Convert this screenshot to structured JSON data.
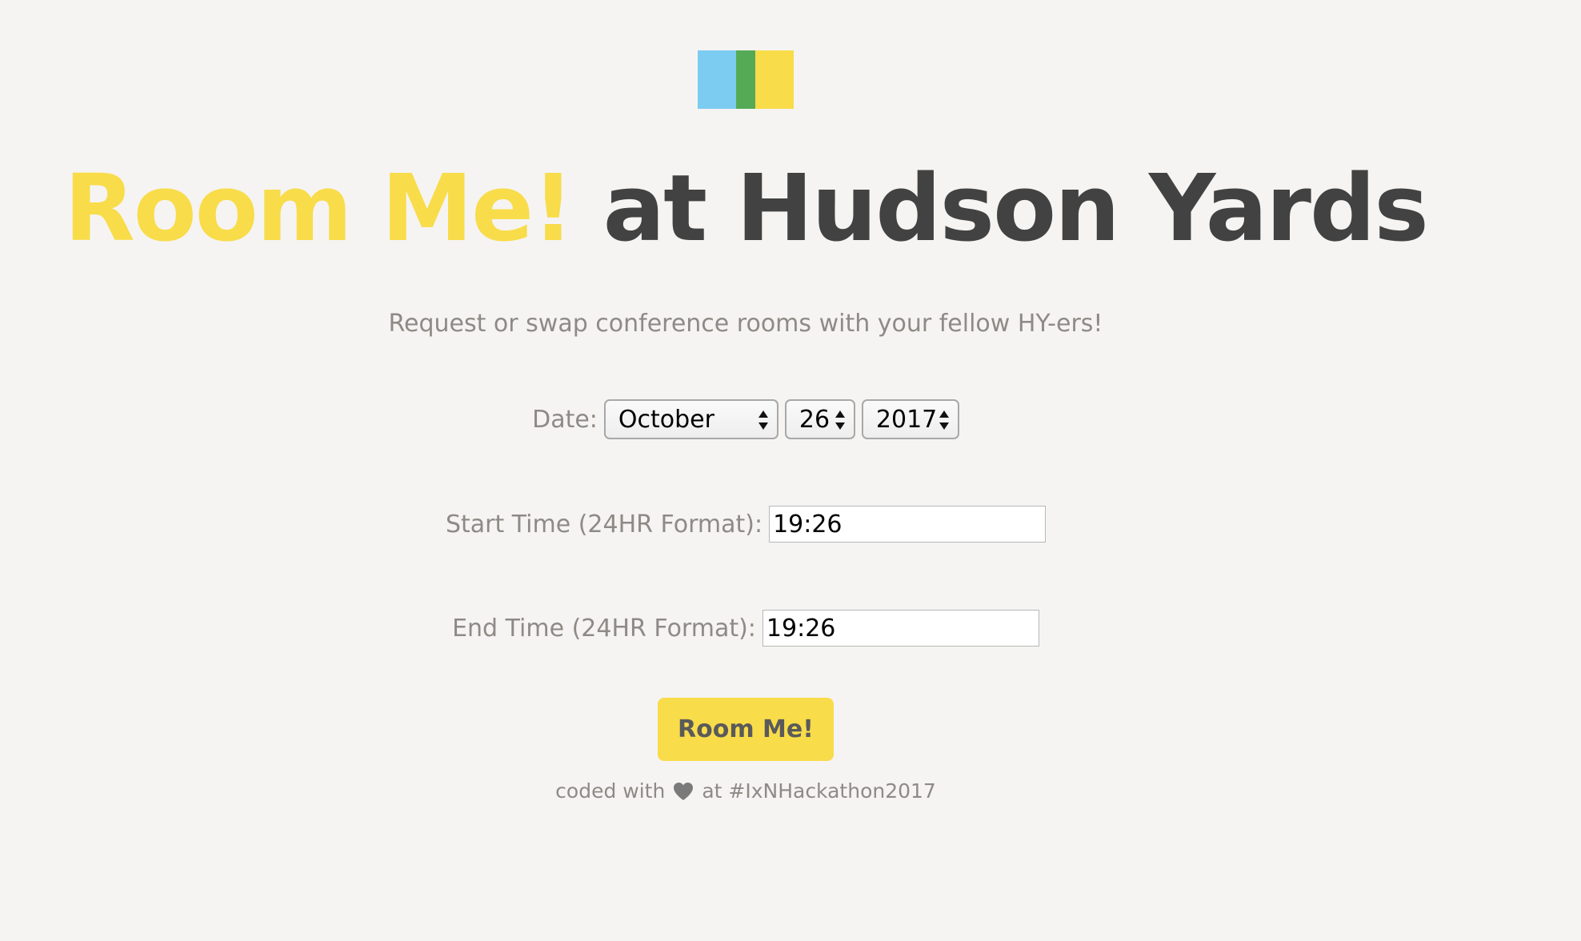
{
  "logo": {
    "colors": {
      "blue": "#7ccbf0",
      "green": "#55aa56",
      "yellow": "#f8dc4a"
    }
  },
  "title": {
    "highlight": "Room Me!",
    "rest": " at Hudson Yards",
    "highlight_color": "#f8dc4a",
    "rest_color": "#424242"
  },
  "subtitle": "Request or swap conference rooms with your fellow HY-ers!",
  "form": {
    "date_label": "Date:",
    "month": "October",
    "day": "26",
    "year": "2017",
    "start_label": "Start Time (24HR Format):",
    "start_value": "19:26",
    "end_label": "End Time (24HR Format):",
    "end_value": "19:26",
    "submit_label": "Room Me!"
  },
  "footer": {
    "prefix": "coded with",
    "icon": "heart-icon",
    "suffix": "at #IxNHackathon2017"
  },
  "colors": {
    "background": "#f5f4f2",
    "muted_text": "#8e8a86",
    "button_bg": "#f8dc4a",
    "button_text": "#5a5a5a",
    "heart": "#7a7a7a"
  }
}
